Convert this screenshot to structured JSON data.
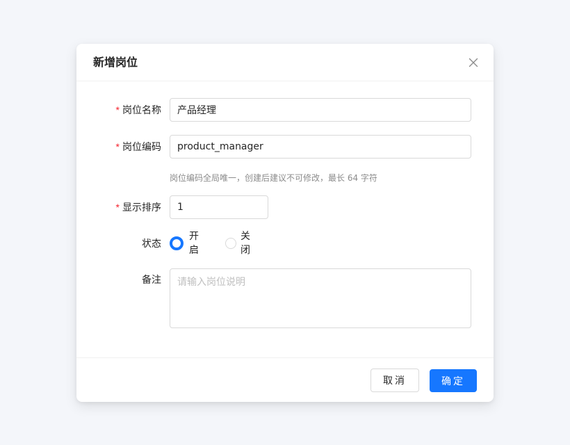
{
  "dialog": {
    "title": "新增岗位",
    "close_icon": "close-icon"
  },
  "form": {
    "name": {
      "label": "岗位名称",
      "required": "*",
      "value": "产品经理"
    },
    "code": {
      "label": "岗位编码",
      "required": "*",
      "value": "product_manager",
      "hint": "岗位编码全局唯一，创建后建议不可修改，最长 64 字符"
    },
    "sort": {
      "label": "显示排序",
      "required": "*",
      "value": "1"
    },
    "status": {
      "label": "状态",
      "options": [
        {
          "label": "开启",
          "checked": true
        },
        {
          "label": "关闭",
          "checked": false
        }
      ]
    },
    "remark": {
      "label": "备注",
      "value": "",
      "placeholder": "请输入岗位说明"
    }
  },
  "footer": {
    "cancel_label": "取消",
    "ok_label": "确定"
  },
  "colors": {
    "primary": "#1677ff",
    "required": "#f5222d",
    "background": "#f4f6fa"
  }
}
